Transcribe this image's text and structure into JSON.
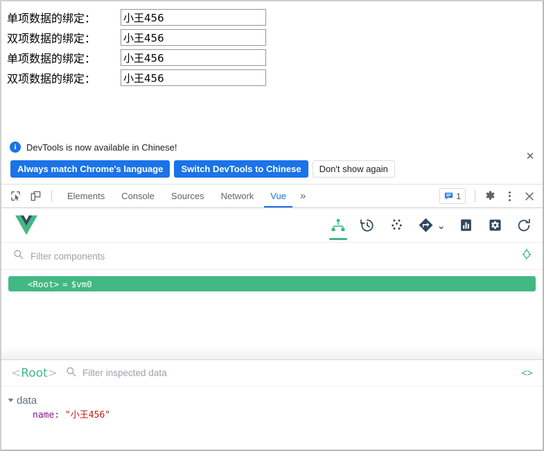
{
  "page": {
    "rows": [
      {
        "label": "单项数据的绑定：",
        "value": "小王456",
        "name": "one-way-binding-1"
      },
      {
        "label": "双项数据的绑定：",
        "value": "小王456",
        "name": "two-way-binding-1"
      },
      {
        "label": "单项数据的绑定：",
        "value": "小王456",
        "name": "one-way-binding-2"
      },
      {
        "label": "双项数据的绑定：",
        "value": "小王456",
        "name": "two-way-binding-2"
      }
    ]
  },
  "infobar": {
    "icon": "info-icon",
    "message": "DevTools is now available in Chinese!",
    "buttons": [
      {
        "label": "Always match Chrome's language",
        "style": "primary",
        "name": "always-match-chrome-language-button"
      },
      {
        "label": "Switch DevTools to Chinese",
        "style": "primary",
        "name": "switch-devtools-to-chinese-button"
      },
      {
        "label": "Don't show again",
        "style": "secondary",
        "name": "dont-show-again-button"
      }
    ],
    "close_label": "✕"
  },
  "tabbar": {
    "left_icons": [
      {
        "name": "inspect-element-icon",
        "title": "Inspect"
      },
      {
        "name": "device-toolbar-icon",
        "title": "Toggle device toolbar"
      }
    ],
    "tabs": [
      {
        "label": "Elements",
        "active": false,
        "name": "tab-elements"
      },
      {
        "label": "Console",
        "active": false,
        "name": "tab-console"
      },
      {
        "label": "Sources",
        "active": false,
        "name": "tab-sources"
      },
      {
        "label": "Network",
        "active": false,
        "name": "tab-network"
      },
      {
        "label": "Vue",
        "active": true,
        "name": "tab-vue"
      }
    ],
    "more_label": "»",
    "message_count": "1",
    "right_icons": [
      {
        "name": "message-badge-icon"
      },
      {
        "name": "settings-gear-icon"
      },
      {
        "name": "more-options-kebab-icon"
      },
      {
        "name": "close-devtools-icon"
      }
    ],
    "close_label": "✕"
  },
  "vue_panel": {
    "logo_name": "vue-logo",
    "toolbar_icons": [
      {
        "name": "components-tree-icon",
        "active": true,
        "title": "Components"
      },
      {
        "name": "timeline-history-icon",
        "active": false,
        "title": "Timeline"
      },
      {
        "name": "vuex-dots-icon",
        "active": false,
        "title": "Vuex"
      },
      {
        "name": "routes-diamond-icon",
        "active": false,
        "title": "Routes"
      },
      {
        "name": "performance-bars-icon",
        "active": false,
        "title": "Performance"
      },
      {
        "name": "settings-cog-icon",
        "active": false,
        "title": "Settings"
      },
      {
        "name": "refresh-icon",
        "active": false,
        "title": "Refresh"
      }
    ],
    "chevron_label": "⌄",
    "filter": {
      "placeholder": "Filter components",
      "value": "",
      "search_icon": "search-icon",
      "select_icon": "component-selector-icon"
    },
    "tree": [
      {
        "tag": "<Root>",
        "assign": "=",
        "vm": "$vm0",
        "selected": true,
        "name": "component-tree-row-root"
      }
    ]
  },
  "inspector": {
    "title_open": "<",
    "title_name": "Root",
    "title_close": ">",
    "filter": {
      "placeholder": "Filter inspected data",
      "value": "",
      "search_icon": "search-icon"
    },
    "code_toggle": "<>",
    "groups": [
      {
        "title": "data",
        "expanded": true,
        "entries": [
          {
            "key": "name",
            "sep": ": ",
            "value": "\"小王456\"",
            "type": "string"
          }
        ]
      }
    ]
  },
  "colors": {
    "vue_green": "#42b883",
    "chrome_blue": "#1a73e8",
    "dark_slate": "#30475e",
    "string_red": "#c41a16",
    "key_purple": "#881391"
  }
}
